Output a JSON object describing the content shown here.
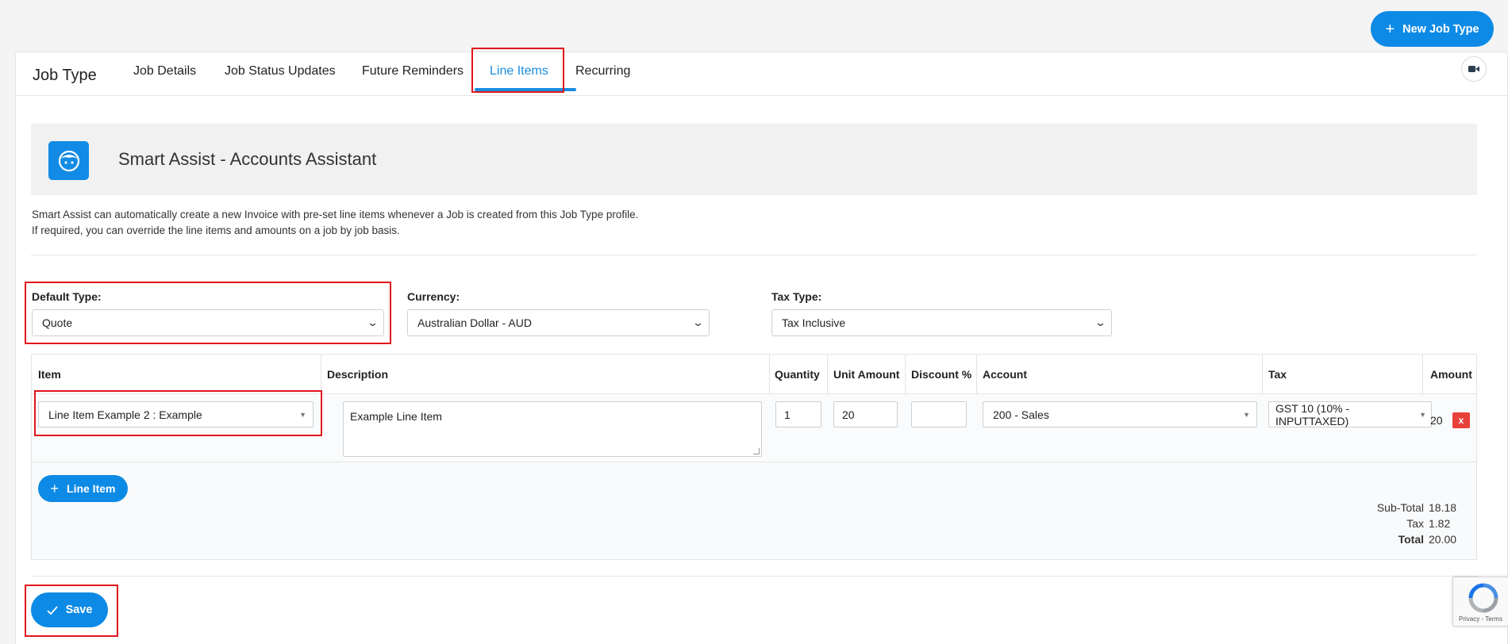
{
  "header": {
    "new_job_type_label": "New Job Type"
  },
  "tabs": {
    "title": "Job Type",
    "items": [
      {
        "label": "Job Details"
      },
      {
        "label": "Job Status Updates"
      },
      {
        "label": "Future Reminders"
      },
      {
        "label": "Line Items"
      },
      {
        "label": "Recurring"
      }
    ],
    "active": "Line Items"
  },
  "assist": {
    "title": "Smart Assist - Accounts Assistant",
    "line1": "Smart Assist can automatically create a new Invoice with pre-set line items whenever a Job is created from this Job Type profile.",
    "line2": "If required, you can override the line items and amounts on a job by job basis."
  },
  "fields": {
    "default_type": {
      "label": "Default Type:",
      "value": "Quote"
    },
    "currency": {
      "label": "Currency:",
      "value": "Australian Dollar - AUD"
    },
    "tax_type": {
      "label": "Tax Type:",
      "value": "Tax Inclusive"
    }
  },
  "table": {
    "headers": {
      "item": "Item",
      "description": "Description",
      "quantity": "Quantity",
      "unit_amount": "Unit Amount",
      "discount": "Discount %",
      "account": "Account",
      "tax": "Tax",
      "amount": "Amount"
    },
    "rows": [
      {
        "item": "Line Item Example 2 : Example",
        "description": "Example Line Item",
        "quantity": "1",
        "unit_amount": "20",
        "discount": "",
        "account": "200 - Sales",
        "tax": "GST 10 (10% - INPUTTAXED)",
        "amount": "20",
        "delete_label": "x"
      }
    ],
    "add_line_item_label": "Line Item"
  },
  "totals": {
    "subtotal_label": "Sub-Total",
    "subtotal_value": "18.18",
    "tax_label": "Tax",
    "tax_value": "1.82",
    "total_label": "Total",
    "total_value": "20.00"
  },
  "actions": {
    "save_label": "Save"
  },
  "recaptcha": {
    "text": "Privacy - Terms"
  },
  "colors": {
    "primary": "#0d8ae5",
    "active_tab": "#1a8ee0",
    "highlight": "#e2161c",
    "danger": "#e8413a"
  }
}
